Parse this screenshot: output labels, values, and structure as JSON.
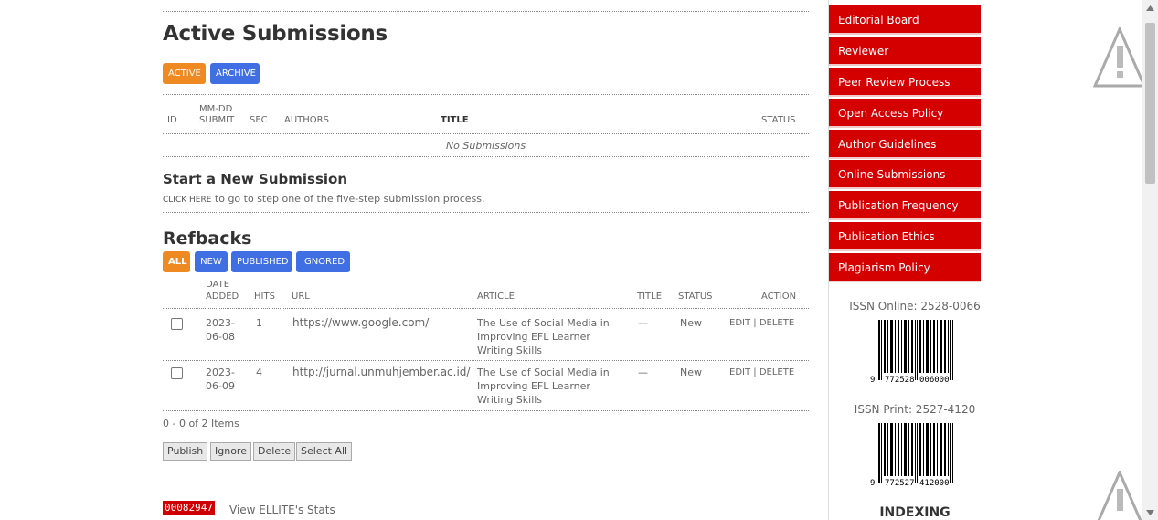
{
  "active": {
    "title": "Active Submissions",
    "tabs": [
      "ACTIVE",
      "ARCHIVE"
    ],
    "headers": {
      "id": "ID",
      "mmdd": "MM-DD",
      "submit": "SUBMIT",
      "sec": "SEC",
      "authors": "AUTHORS",
      "title": "TITLE",
      "status": "STATUS"
    },
    "empty": "No Submissions"
  },
  "newsub": {
    "title": "Start a New Submission",
    "link": "CLICK HERE",
    "text": " to go to step one of the five-step submission process."
  },
  "refbacks": {
    "title": "Refbacks",
    "tabs": [
      "ALL",
      "NEW",
      "PUBLISHED",
      "IGNORED"
    ],
    "headers": {
      "date": "DATE",
      "added": "ADDED",
      "hits": "HITS",
      "url": "URL",
      "article": "ARTICLE",
      "title": "TITLE",
      "status": "STATUS",
      "action": "ACTION"
    },
    "rows": [
      {
        "date1": "2023-",
        "date2": "06-08",
        "hits": "1",
        "url": "https://www.google.com/",
        "art1": "The Use of Social Media in",
        "art2": "Improving EFL Learner",
        "art3": "Writing Skills",
        "title": "—",
        "status": "New",
        "edit": "EDIT",
        "sep": "|",
        "delete": "DELETE"
      },
      {
        "date1": "2023-",
        "date2": "06-09",
        "hits": "4",
        "url": "http://jurnal.unmuhjember.ac.id/",
        "art1": "The Use of Social Media in",
        "art2": "Improving EFL Learner",
        "art3": "Writing Skills",
        "title": "—",
        "status": "New",
        "edit": "EDIT",
        "sep": "|",
        "delete": "DELETE"
      }
    ],
    "count": "0 - 0 of 2 Items",
    "buttons": [
      "Publish",
      "Ignore",
      "Delete",
      "Select All"
    ]
  },
  "stats": {
    "counter": "00082947",
    "link": "View ELLITE's Stats"
  },
  "sidebar": {
    "items": [
      "Editorial Board",
      "Reviewer",
      "Peer Review Process",
      "Open Access Policy",
      "Author Guidelines",
      "Online Submissions",
      "Publication Frequency",
      "Publication Ethics",
      "Plagiarism Policy"
    ],
    "issn_online": "ISSN Online: 2528-0066",
    "barcode1": {
      "lead": "9",
      "left": "772528",
      "right": "006000"
    },
    "issn_print": "ISSN Print: 2527-4120",
    "barcode2": {
      "lead": "9",
      "left": "772527",
      "right": "412000"
    },
    "indexing": "INDEXING"
  },
  "icons": {
    "warning": "warning-triangle-icon",
    "scroll_up": "chevron-up-icon",
    "scroll_down": "chevron-down-icon"
  }
}
